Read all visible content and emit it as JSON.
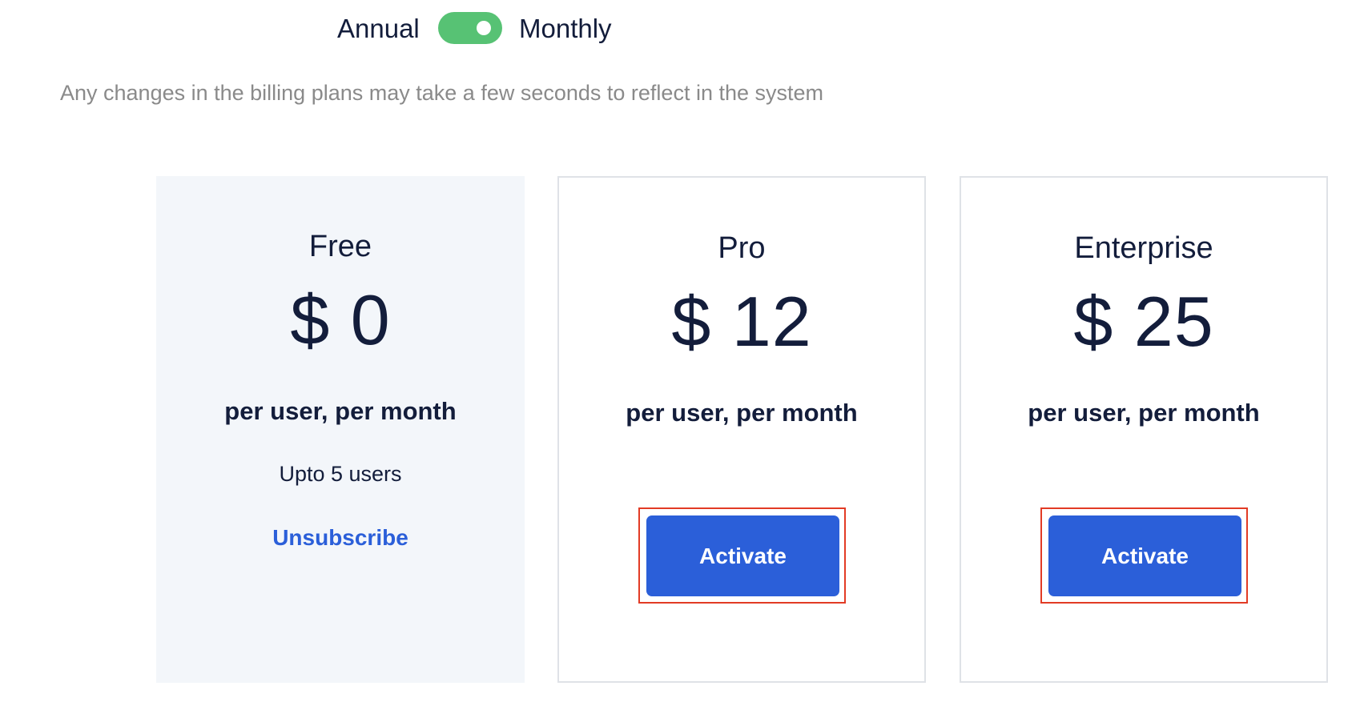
{
  "colors": {
    "toggle_on": "#57c274",
    "primary_button": "#2b5fd9",
    "link": "#2b5fd9",
    "current_plan_bg": "#f3f6fa",
    "highlight_outline": "#e23b25",
    "heading_text": "#131d3b",
    "muted_text": "#8a8a8a"
  },
  "billing_toggle": {
    "left_label": "Annual",
    "right_label": "Monthly",
    "selected": "Monthly"
  },
  "notice": "Any changes in the billing plans may take a few seconds to reflect in the system",
  "plans": [
    {
      "name": "Free",
      "price": "$ 0",
      "period": "per user, per month",
      "users": "Upto 5 users",
      "action_label": "Unsubscribe",
      "current": true
    },
    {
      "name": "Pro",
      "price": "$ 12",
      "period": "per user, per month",
      "action_label": "Activate",
      "current": false
    },
    {
      "name": "Enterprise",
      "price": "$ 25",
      "period": "per user, per month",
      "action_label": "Activate",
      "current": false
    }
  ]
}
